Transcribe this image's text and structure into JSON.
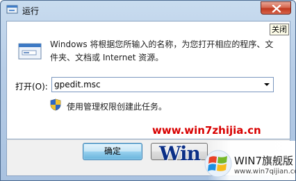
{
  "window": {
    "title": "运行",
    "close_tooltip": "关闭"
  },
  "dialog": {
    "description": "Windows 将根据您所输入的名称，为您打开相应的程序、文件夹、文档或 Internet 资源。",
    "open_label": "打开(O):",
    "open_value": "gpedit.msc",
    "admin_note": "使用管理权限创建此任务。"
  },
  "buttons": {
    "ok_label": "确定"
  },
  "watermark": {
    "url": "www.win7zhijia.cn",
    "logo_text": "Win",
    "badge_title": "WIN7旗舰版",
    "badge_url": "www.win7qijian.com"
  },
  "colors": {
    "title_gradient_top": "#c9dcef",
    "close_red": "#c0391f",
    "watermark_red": "#d80000",
    "ok_blue": "#68b3db"
  },
  "icons": [
    "run-dialog-app-icon",
    "close-icon",
    "run-icon",
    "uac-shield-icon",
    "windows-flag-icon",
    "dropdown-arrow-icon"
  ]
}
